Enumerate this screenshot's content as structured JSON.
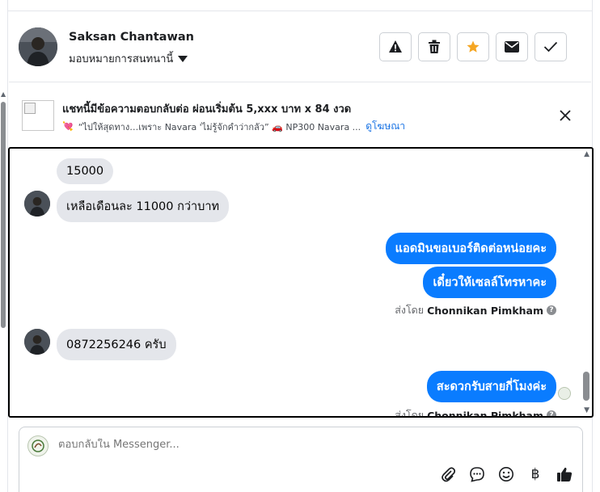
{
  "header": {
    "contact_name": "Saksan Chantawan",
    "assign_label": "มอบหมายการสนทนานี้",
    "actions": [
      {
        "name": "alert-icon"
      },
      {
        "name": "trash-icon"
      },
      {
        "name": "star-icon",
        "color": "#f5a623"
      },
      {
        "name": "mail-icon"
      },
      {
        "name": "check-icon"
      }
    ]
  },
  "ad": {
    "title": "แชทนี้มีข้อความตอบกลับต่อ ผ่อนเริ่มต้น 5,xxx บาท x 84 งวด",
    "subtitle": "“ไปให้สุดทาง…เพราะ Navara 'ไม่รู้จักคำว่ากลัว” 🚗 NP300 Navara ...",
    "subtitle_icon": "💘",
    "link": "ดูโฆษณา"
  },
  "messages": {
    "in1": "15000",
    "in2": "เหลือเดือนละ 11000 กว่าบาท",
    "out1": "แอดมินขอเบอร์ติดต่อหน่อยคะ",
    "out2": "เดี๋ยวให้เซลล์โทรหาคะ",
    "in3": "0872256246 ครับ",
    "out3": "สะดวกรับสายกี่โมงค่ะ",
    "sent_by_prefix": "ส่งโดย",
    "sent_by_name": "Chonnikan Pimkham"
  },
  "composer": {
    "placeholder": "ตอบกลับใน Messenger..."
  },
  "colors": {
    "outgoing_bubble": "#0a7cff",
    "incoming_bubble": "#e4e6eb",
    "link": "#1b74e4"
  }
}
